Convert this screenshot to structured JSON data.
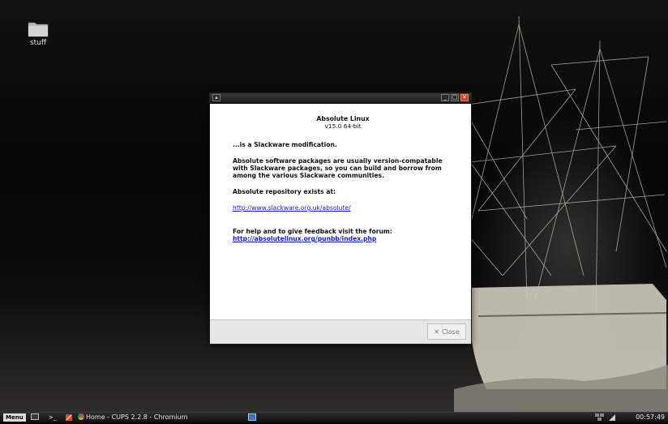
{
  "desktop": {
    "icons": [
      {
        "label": "stuff",
        "icon": "folder-icon"
      }
    ]
  },
  "dialog": {
    "title_line": "Absolute Linux",
    "version_line": "v15.0  64-bit",
    "tagline": "...is a Slackware modification.",
    "paragraph": "Absolute software packages are usually version-compatable with Slackware packages, so you can build and borrow from among the various Slackware communities.",
    "repo_heading": "Absolute repository exists at:",
    "repo_link": "http://www.slackware.org.uk/absolute/",
    "forum_text": "For help and to give feedback visit the forum:",
    "forum_link": "http://absolutelinux.org/punbb/index.php",
    "close_label": "Close",
    "close_icon": "✕"
  },
  "taskbar": {
    "menu_label": "Menu",
    "terminal_glyph": ">_",
    "task_label": "Home - CUPS 2.2.8 - Chromium",
    "clock": "00:57:49"
  }
}
